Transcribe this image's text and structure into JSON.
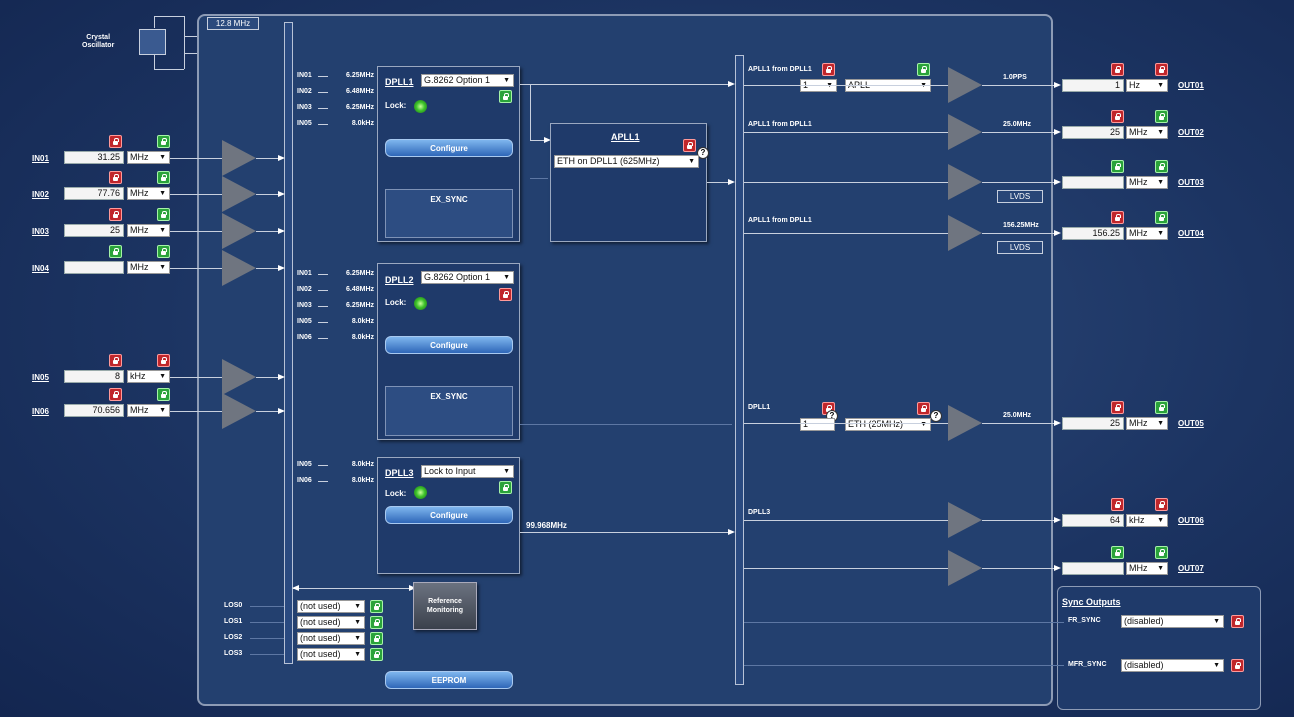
{
  "top_freq_label": "12.8 MHz",
  "crystal": {
    "label": "Crystal\nOscillator"
  },
  "inputs": [
    {
      "name": "IN01",
      "value": "31.25",
      "unit": "MHz"
    },
    {
      "name": "IN02",
      "value": "77.76",
      "unit": "MHz"
    },
    {
      "name": "IN03",
      "value": "25",
      "unit": "MHz"
    },
    {
      "name": "IN04",
      "value": "",
      "unit": "MHz"
    },
    {
      "name": "IN05",
      "value": "8",
      "unit": "kHz"
    },
    {
      "name": "IN06",
      "value": "70.656",
      "unit": "MHz"
    }
  ],
  "dpll1": {
    "title": "DPLL1",
    "mode": "G.8262 Option 1",
    "lock_label": "Lock:",
    "configure": "Configure",
    "ex_sync": "EX_SYNC",
    "inputs": [
      {
        "n": "IN01",
        "f": "6.25MHz"
      },
      {
        "n": "IN02",
        "f": "6.48MHz"
      },
      {
        "n": "IN03",
        "f": "6.25MHz"
      },
      {
        "n": "IN05",
        "f": "8.0kHz"
      }
    ]
  },
  "dpll2": {
    "title": "DPLL2",
    "mode": "G.8262 Option 1",
    "lock_label": "Lock:",
    "configure": "Configure",
    "ex_sync": "EX_SYNC",
    "inputs": [
      {
        "n": "IN01",
        "f": "6.25MHz"
      },
      {
        "n": "IN02",
        "f": "6.48MHz"
      },
      {
        "n": "IN03",
        "f": "6.25MHz"
      },
      {
        "n": "IN05",
        "f": "8.0kHz"
      },
      {
        "n": "IN06",
        "f": "8.0kHz"
      }
    ]
  },
  "dpll3": {
    "title": "DPLL3",
    "mode": "Lock to Input",
    "lock_label": "Lock:",
    "configure": "Configure",
    "out_freq": "99.968MHz",
    "inputs": [
      {
        "n": "IN05",
        "f": "8.0kHz"
      },
      {
        "n": "IN06",
        "f": "8.0kHz"
      }
    ]
  },
  "apll1": {
    "title": "APLL1",
    "mode": "ETH on DPLL1 (625MHz)"
  },
  "routes": {
    "r1": "APLL1 from DPLL1",
    "r2": "APLL1 from DPLL1",
    "r4": "APLL1 from DPLL1",
    "r5": "DPLL1",
    "r6": "DPLL3"
  },
  "out1_div": "1",
  "out1_src": "APLL",
  "out5_div": "1",
  "out5_src": "ETH (25MHz)",
  "outputs": [
    {
      "name": "OUT01",
      "freq": "1.0PPS",
      "value": "1",
      "unit": "Hz",
      "lvds": ""
    },
    {
      "name": "OUT02",
      "freq": "25.0MHz",
      "value": "25",
      "unit": "MHz",
      "lvds": ""
    },
    {
      "name": "OUT03",
      "freq": "",
      "value": "",
      "unit": "MHz",
      "lvds": "LVDS"
    },
    {
      "name": "OUT04",
      "freq": "156.25MHz",
      "value": "156.25",
      "unit": "MHz",
      "lvds": "LVDS"
    },
    {
      "name": "OUT05",
      "freq": "25.0MHz",
      "value": "25",
      "unit": "MHz",
      "lvds": ""
    },
    {
      "name": "OUT06",
      "freq": "",
      "value": "64",
      "unit": "kHz",
      "lvds": ""
    },
    {
      "name": "OUT07",
      "freq": "",
      "value": "",
      "unit": "MHz",
      "lvds": ""
    }
  ],
  "los": [
    {
      "name": "LOS0",
      "value": "(not used)"
    },
    {
      "name": "LOS1",
      "value": "(not used)"
    },
    {
      "name": "LOS2",
      "value": "(not used)"
    },
    {
      "name": "LOS3",
      "value": "(not used)"
    }
  ],
  "ref_mon": "Reference\nMonitoring",
  "eeprom": "EEPROM",
  "sync": {
    "title": "Sync Outputs",
    "fr_label": "FR_SYNC",
    "fr_value": "(disabled)",
    "mfr_label": "MFR_SYNC",
    "mfr_value": "(disabled)"
  },
  "colors": {
    "lock_red": "#c0262b",
    "lock_green": "#2aa33a",
    "panel": "#23406f"
  }
}
